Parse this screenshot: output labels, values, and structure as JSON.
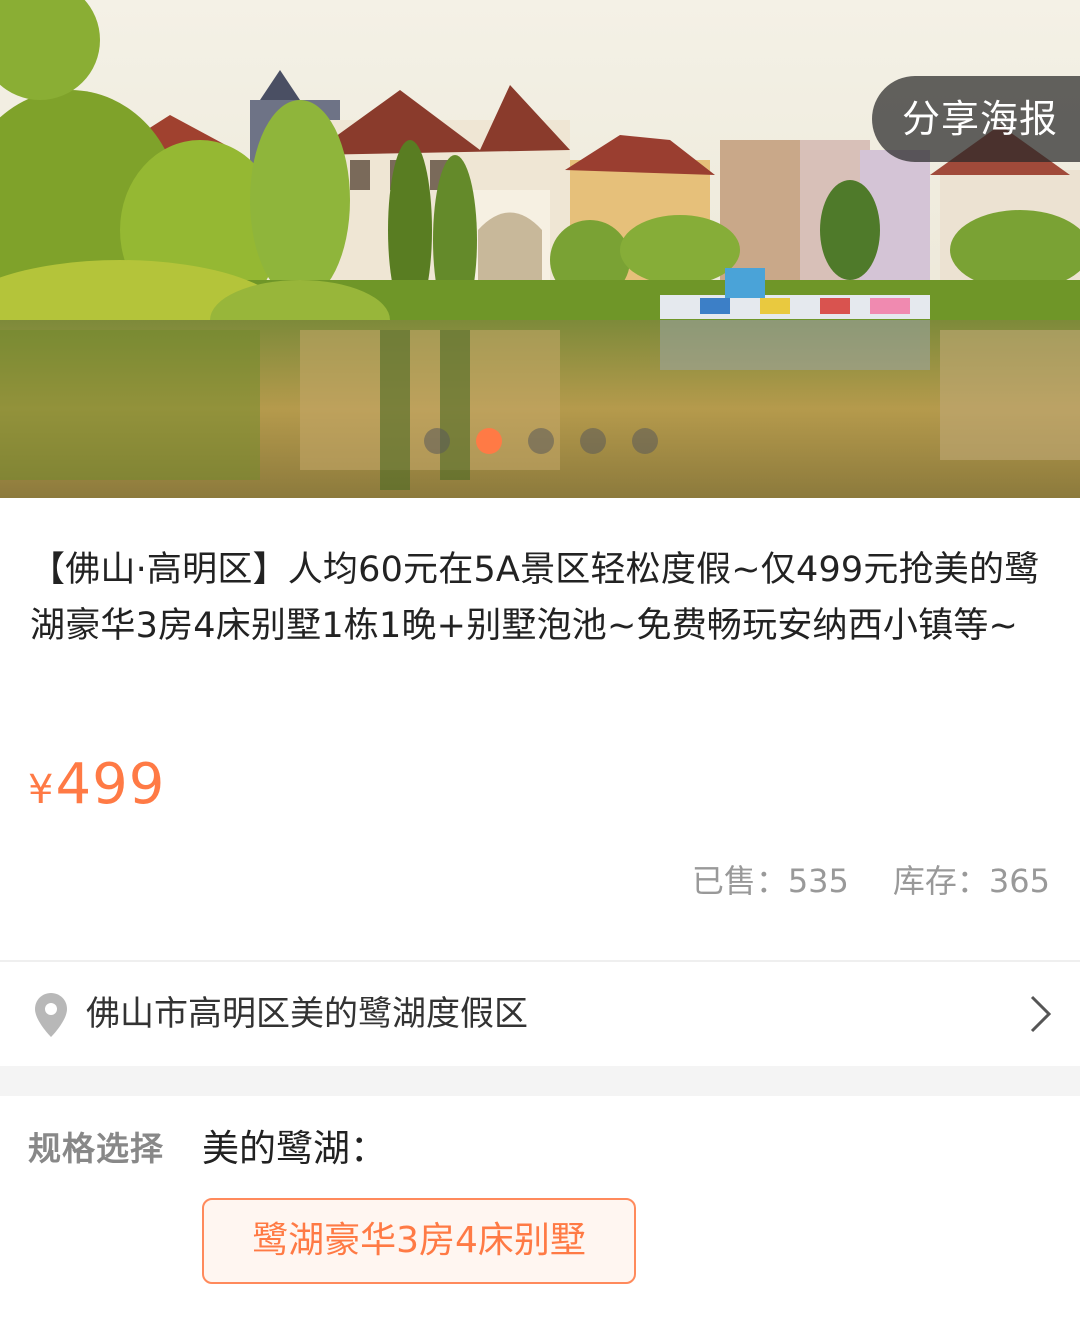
{
  "hero": {
    "share_label": "分享海报",
    "dot_count": 5,
    "active_dot": 1
  },
  "product": {
    "title": "【佛山·高明区】人均60元在5A景区轻松度假~仅499元抢美的鹭湖豪华3房4床别墅1栋1晚+别墅泡池~免费畅玩安纳西小镇等~",
    "currency": "¥",
    "price": "499",
    "sold": "已售：535",
    "stock": "库存：365"
  },
  "location": {
    "address": "佛山市高明区美的鹭湖度假区"
  },
  "spec": {
    "label": "规格选择",
    "group": "美的鹭湖：",
    "options": [
      "鹭湖豪华3房4床别墅"
    ]
  },
  "colors": {
    "accent": "#ff7a45",
    "muted": "#999999",
    "band": "#f4f4f4"
  }
}
